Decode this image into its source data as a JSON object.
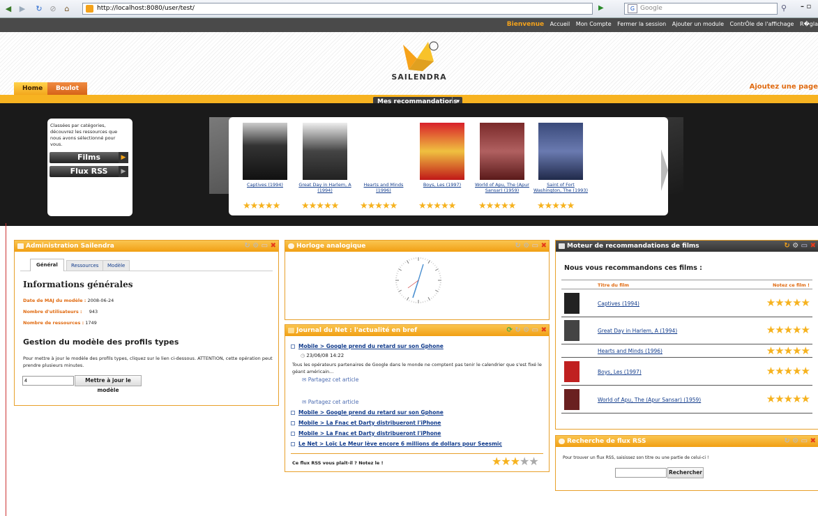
{
  "browser": {
    "url": "http://localhost:8080/user/test/",
    "search_placeholder": "Google"
  },
  "topbar": {
    "welcome": "Bienvenue",
    "links": [
      "Accueil",
      "Mon Compte",
      "Fermer la session",
      "Ajouter un module",
      "ContrÔle de l'affichage",
      "R�gla"
    ]
  },
  "header": {
    "logo_text": "SAILENDRA",
    "tabs": [
      "Home",
      "Boulot"
    ],
    "add_page": "Ajoutez une page"
  },
  "reco_dropdown": "Mes recommandations",
  "banner": {
    "intro_text": "Classées par catégories, découvrez les ressources que nous avons sélectionné pour vous.",
    "buttons": [
      "Films",
      "Flux RSS"
    ],
    "films": [
      {
        "title": "Captives (1994)",
        "stars": 5
      },
      {
        "title": "Great Day in Harlem, A (1994)",
        "stars": 5
      },
      {
        "title": "Hearts and Minds (1996)",
        "stars": 5
      },
      {
        "title": "Boys, Les (1997)",
        "stars": 5
      },
      {
        "title": "World of Apu, The (Apur Sansar) (1959)",
        "stars": 5
      },
      {
        "title": "Saint of Fort Washington, The (1993)",
        "stars": 5
      }
    ]
  },
  "admin": {
    "title": "Administration Sailendra",
    "tabs": [
      "Général",
      "Ressources",
      "Modèle"
    ],
    "section1": "Informations générales",
    "info": [
      {
        "label": "Date de MAJ du modèle :",
        "value": "2008-06-24"
      },
      {
        "label": "Nombre d'utilisateurs :",
        "value": "943"
      },
      {
        "label": "Nombre de ressources :",
        "value": "1749"
      }
    ],
    "section2": "Gestion du modèle des profils types",
    "desc": "Pour mettre à jour le modèle des profils types, cliquez sur le lien ci-dessous. ATTENTION, cette opération peut prendre plusieurs minutes.",
    "input_value": "4",
    "button": "Mettre à jour le modèle"
  },
  "clock": {
    "title": "Horloge analogique"
  },
  "news": {
    "title": "Journal du Net : l'actualité en bref",
    "first": {
      "title": "Mobile > Google prend du retard sur son Gphone",
      "date": "23/06/08 14:22",
      "body": "Tous les opérateurs partenaires de Google dans le monde ne comptent pas tenir le calendrier que s'est fixé le géant américain...",
      "share": "Partagez cet article"
    },
    "share2": "Partagez cet article",
    "items": [
      "Mobile > Google prend du retard sur son Gphone",
      "Mobile > La Fnac et Darty distribueront l'iPhone",
      "Mobile > La Fnac et Darty distribueront l'iPhone",
      "Le Net > Loïc Le Meur lève encore 6 millions de dollars pour Seesmic"
    ],
    "rate_text": "Ce flux RSS vous plaît-il ? Notez le !",
    "rating": 3
  },
  "reco": {
    "title": "Moteur de recommandations de films",
    "heading": "Nous vous recommandons ces films :",
    "col_title": "Titre du film",
    "col_rate": "Notez ce film !",
    "rows": [
      {
        "title": "Captives (1994)",
        "stars": 5
      },
      {
        "title": "Great Day in Harlem, A (1994)",
        "stars": 5
      },
      {
        "title": "Hearts and Minds (1996)",
        "stars": 5
      },
      {
        "title": "Boys, Les (1997)",
        "stars": 5
      },
      {
        "title": "World of Apu, The (Apur Sansar) (1959)",
        "stars": 5
      }
    ]
  },
  "rss_search": {
    "title": "Recherche de flux RSS",
    "desc": "Pour trouver un flux RSS, saisissez son titre ou une partie de celui-ci !",
    "button": "Rechercher"
  },
  "colors": {
    "accent": "#f7b321",
    "link": "#123c8c",
    "star": "#f6b21e",
    "label": "#e06a10"
  }
}
